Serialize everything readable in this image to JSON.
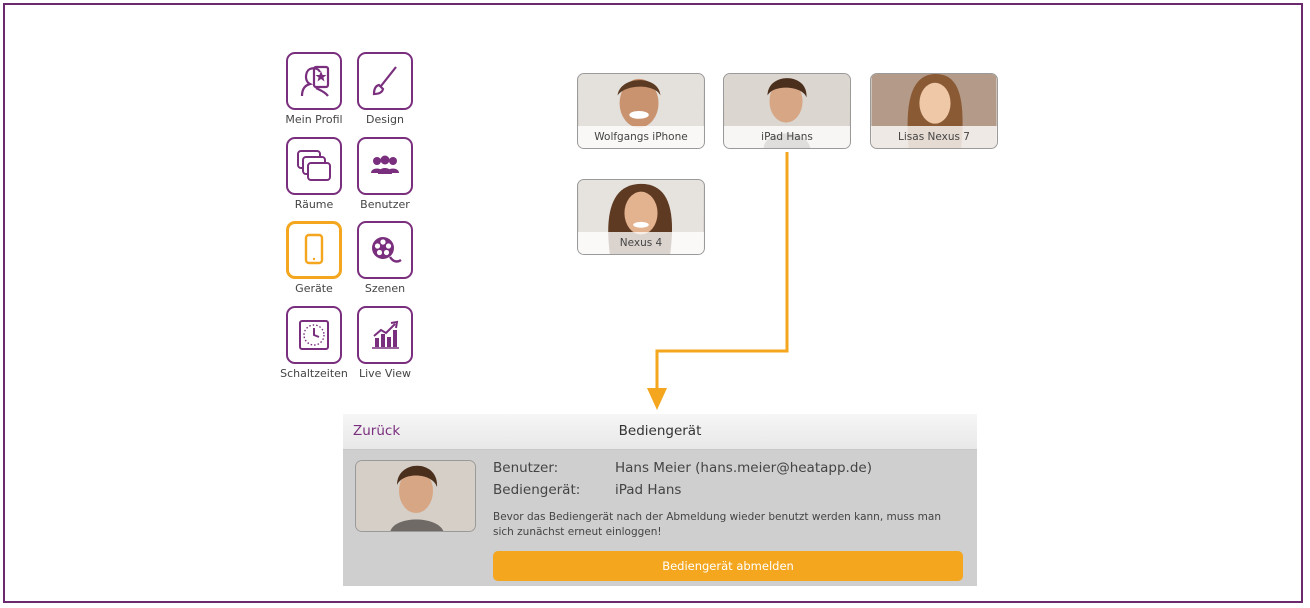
{
  "menu": {
    "items": [
      {
        "label": "Mein Profil",
        "icon": "profile-star-icon"
      },
      {
        "label": "Design",
        "icon": "paintbrush-icon"
      },
      {
        "label": "Räume",
        "icon": "rooms-icon"
      },
      {
        "label": "Benutzer",
        "icon": "users-icon"
      },
      {
        "label": "Geräte",
        "icon": "phone-icon",
        "active": true
      },
      {
        "label": "Szenen",
        "icon": "film-reel-icon"
      },
      {
        "label": "Schaltzeiten",
        "icon": "clock-icon"
      },
      {
        "label": "Live View",
        "icon": "chart-icon"
      }
    ]
  },
  "devices": [
    {
      "name": "Wolfgangs iPhone"
    },
    {
      "name": "iPad Hans"
    },
    {
      "name": "Lisas Nexus 7"
    },
    {
      "name": "Nexus 4"
    }
  ],
  "detail": {
    "back_label": "Zurück",
    "title": "Bediengerät",
    "user_label": "Benutzer:",
    "user_value": "Hans Meier (hans.meier@heatapp.de)",
    "device_label": "Bediengerät:",
    "device_value": "iPad Hans",
    "note": "Bevor das Bediengerät nach der Abmeldung wieder benutzt werden kann, muss man sich zunächst erneut einloggen!",
    "logout_button": "Bediengerät abmelden"
  },
  "colors": {
    "accent": "#f3a61e",
    "brand_purple": "#7a2f7e",
    "border": "#6b2a6e"
  }
}
